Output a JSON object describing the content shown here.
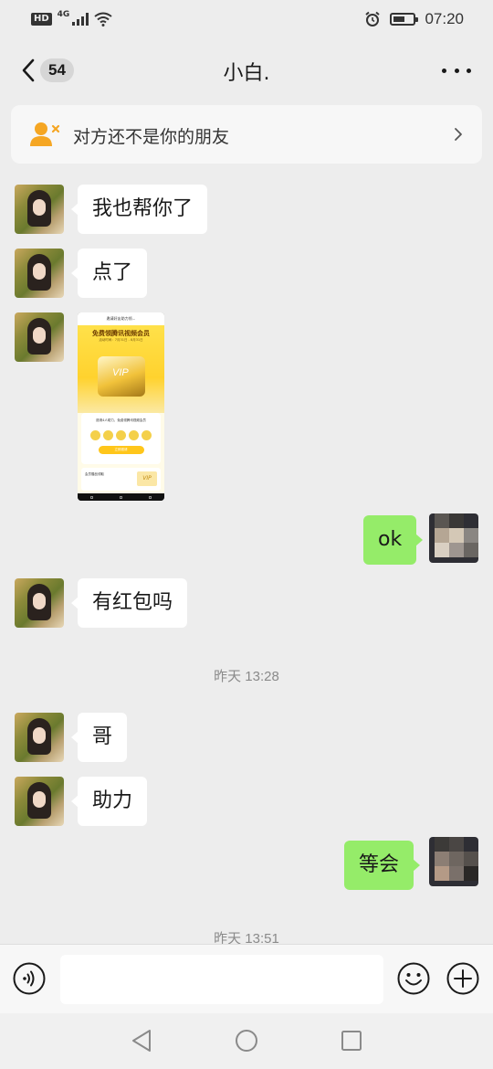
{
  "status_bar": {
    "hd_label": "HD",
    "network_label": "4G",
    "signal_level": 1.0,
    "battery_level": 0.6,
    "time": "07:20",
    "icons": [
      "signal-icon",
      "wifi-icon",
      "alarm-icon",
      "battery-icon"
    ]
  },
  "header": {
    "back_icon": "chevron-left-icon",
    "unread_count": "54",
    "title": "小白.",
    "more_icon": "more-dots-icon"
  },
  "notice": {
    "icon": "user-not-friend-icon",
    "text": "对方还不是你的朋友",
    "arrow_icon": "chevron-right-icon",
    "icon_color": "#f5a623"
  },
  "messages": [
    {
      "side": "left",
      "text": "我也帮你了"
    },
    {
      "side": "left",
      "text": "点了"
    },
    {
      "side": "left",
      "type": "image",
      "image": {
        "top_bar": "邀请好友助力领...",
        "headline": "免费领腾讯视频会员",
        "subline": "活动时间：7月31日 - 8月31日",
        "badge": "VIP",
        "card_text": "邀请4人助力，免费领腾讯视频会员",
        "button": "立即邀请",
        "footer_text": "会员赠品领取",
        "footer_badge": "VIP"
      }
    },
    {
      "side": "right",
      "text": "ok"
    },
    {
      "side": "left",
      "text": "有红包吗"
    },
    {
      "type": "timestamp",
      "text": "昨天 13:28"
    },
    {
      "side": "left",
      "text": "哥"
    },
    {
      "side": "left",
      "text": "助力"
    },
    {
      "side": "right",
      "text": "等会"
    },
    {
      "type": "timestamp",
      "text": "昨天 13:51"
    }
  ],
  "input_bar": {
    "voice_icon": "voice-icon",
    "input_value": "",
    "emoji_icon": "emoji-icon",
    "plus_icon": "plus-icon"
  },
  "system_nav": {
    "icons": [
      "back-triangle-icon",
      "home-circle-icon",
      "recents-square-icon"
    ]
  },
  "colors": {
    "background": "#ededed",
    "bubble_self": "#95ec69",
    "bubble_other": "#ffffff"
  }
}
